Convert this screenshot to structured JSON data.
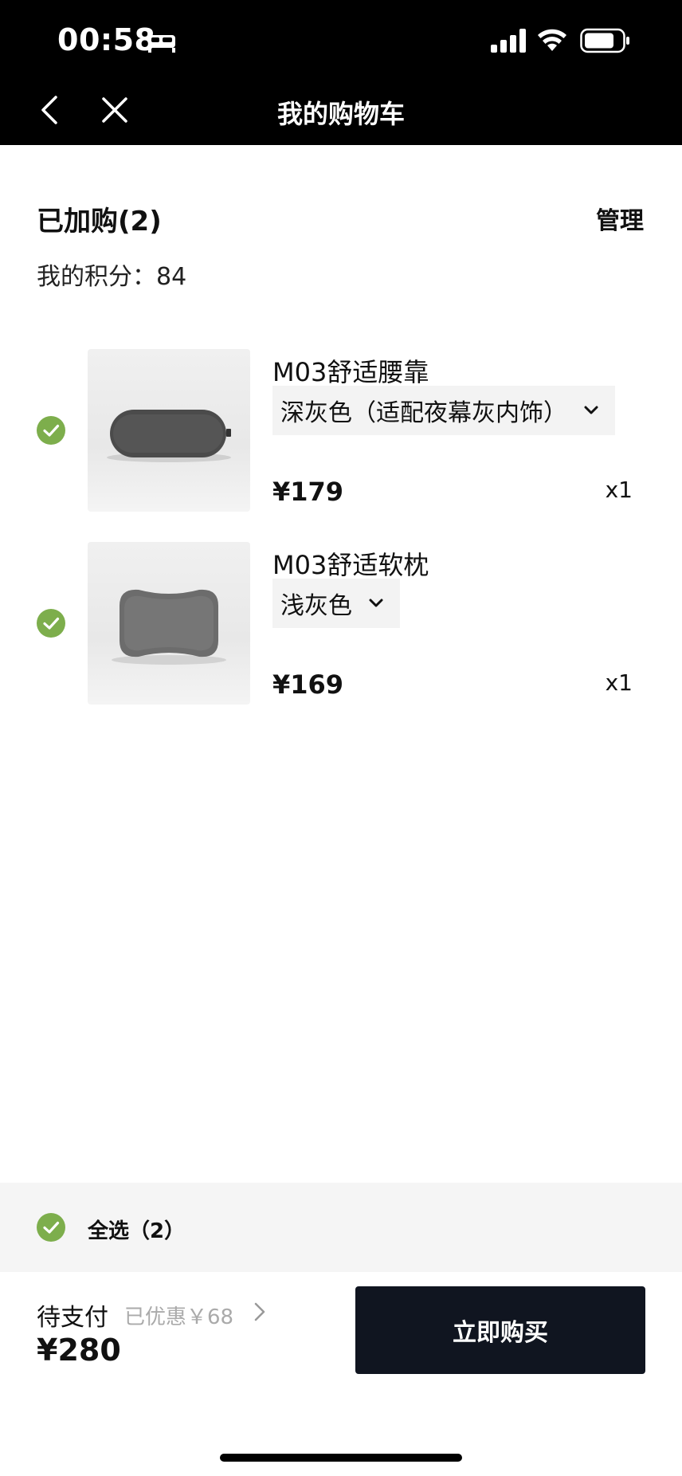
{
  "status_bar": {
    "time": "00:58"
  },
  "nav": {
    "title": "我的购物车"
  },
  "cart": {
    "heading": "已加购(2)",
    "manage_label": "管理",
    "points_label": "我的积分：",
    "points_value": "84"
  },
  "items": [
    {
      "name": "M03舒适腰靠",
      "variant": "深灰色（适配夜幕灰内饰）",
      "price": "¥179",
      "quantity": "x1",
      "selected": true
    },
    {
      "name": "M03舒适软枕",
      "variant": "浅灰色",
      "price": "¥169",
      "quantity": "x1",
      "selected": true
    }
  ],
  "select_all": {
    "label": "全选（2）",
    "selected": true
  },
  "footer": {
    "pay_label": "待支付",
    "discount": "已优惠￥68",
    "total": "¥280",
    "buy_label": "立即购买"
  },
  "colors": {
    "accent_green": "#7DAE4C",
    "button_dark": "#101520",
    "topbar": "#000000"
  }
}
